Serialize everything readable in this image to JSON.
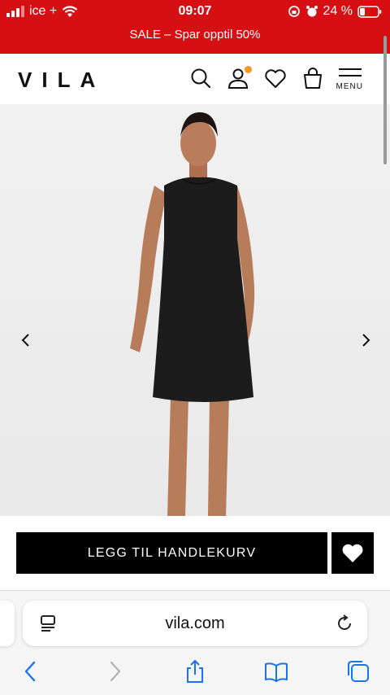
{
  "status_bar": {
    "carrier": "ice +",
    "time": "09:07",
    "battery": "24 %"
  },
  "banner": {
    "text": "SALE – Spar opptil 50%"
  },
  "header": {
    "logo": "VILA",
    "icons": [
      "search-icon",
      "account-icon",
      "heart-icon",
      "bag-icon",
      "menu-icon"
    ],
    "menu_label": "MENU",
    "account_badge_color": "#f39a1e"
  },
  "product": {
    "image": "black-sleeveless-shift-dress"
  },
  "cta": {
    "add_to_cart": "LEGG TIL HANDLEKURV"
  },
  "browser": {
    "url": "vila.com"
  },
  "colors": {
    "brand_red": "#d50f12",
    "ios_blue": "#1a73e8"
  }
}
